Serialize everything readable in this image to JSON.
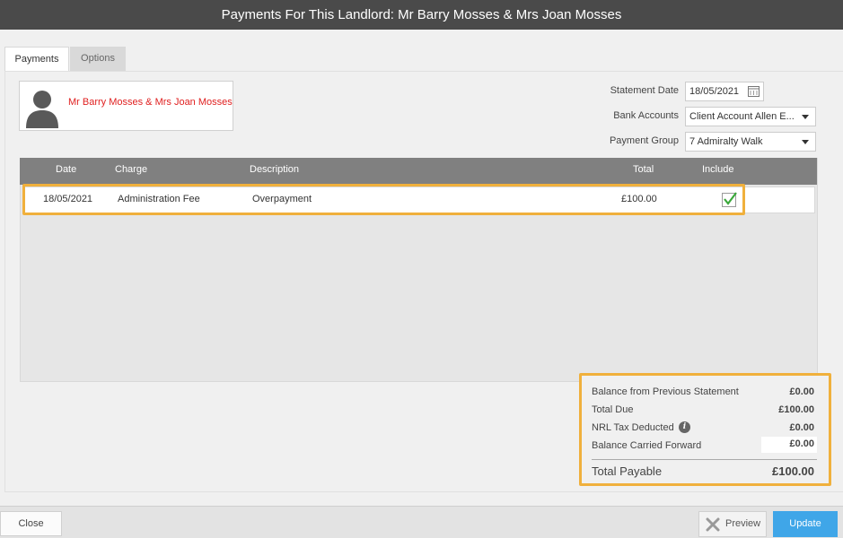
{
  "window": {
    "title": "Payments For This Landlord: Mr Barry Mosses & Mrs Joan Mosses"
  },
  "tabs": [
    {
      "label": "Payments",
      "active": true
    },
    {
      "label": "Options",
      "active": false
    }
  ],
  "landlord": {
    "name": "Mr Barry Mosses & Mrs Joan Mosses"
  },
  "form": {
    "statement_date_label": "Statement Date",
    "statement_date_value": "18/05/2021",
    "bank_accounts_label": "Bank Accounts",
    "bank_accounts_value": "Client Account Allen E...",
    "payment_group_label": "Payment Group",
    "payment_group_value": "7 Admiralty Walk"
  },
  "table": {
    "columns": [
      "Date",
      "Charge",
      "Description",
      "Total",
      "Include"
    ],
    "rows": [
      {
        "date": "18/05/2021",
        "charge": "Administration Fee",
        "description": "Overpayment",
        "total": "£100.00",
        "include": true
      }
    ]
  },
  "summary": {
    "balance_prev_label": "Balance from Previous Statement",
    "balance_prev_value": "£0.00",
    "total_due_label": "Total Due",
    "total_due_value": "£100.00",
    "nrl_tax_label": "NRL Tax Deducted",
    "nrl_tax_value": "£0.00",
    "balance_cf_label": "Balance Carried Forward",
    "balance_cf_value": "£0.00",
    "total_payable_label": "Total Payable",
    "total_payable_value": "£100.00"
  },
  "footer": {
    "close_label": "Close",
    "preview_label": "Preview",
    "update_label": "Update"
  },
  "colors": {
    "titlebar": "#4a4a4a",
    "highlight": "#f0b03c",
    "landlord_name": "#e02020",
    "update_button": "#3fa6e8",
    "checkmark": "#3aa83a"
  },
  "icons": {
    "avatar": "person-silhouette-icon",
    "calendar": "calendar-icon",
    "dropdown": "chevron-down-icon",
    "include": "checkmark-icon",
    "info": "info-icon",
    "preview": "x-icon"
  }
}
